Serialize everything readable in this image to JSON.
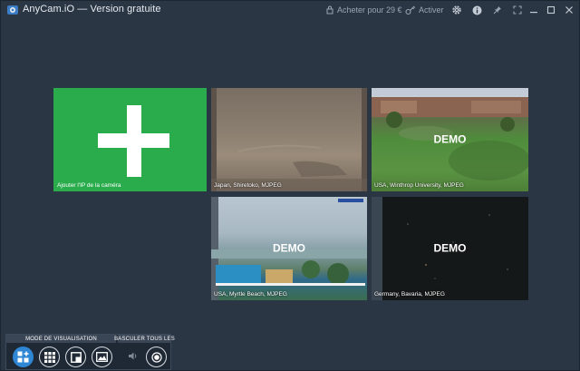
{
  "window": {
    "title": "AnyCam.iO — Version gratuite"
  },
  "titlebar": {
    "buy_label": "Acheter pour 29 €",
    "activate_label": "Activer",
    "icons": [
      "cart-icon",
      "key-icon",
      "gear-icon",
      "info-icon",
      "pin-icon",
      "fullscreen-icon",
      "minimize-icon",
      "maximize-icon",
      "close-icon"
    ]
  },
  "add_tile": {
    "label": "Ajouter l'IP de la caméra",
    "color": "#2aac4c"
  },
  "cameras": [
    {
      "caption": "Japan, Shiretoko, MJPEG",
      "demo": ""
    },
    {
      "caption": "USA, Winthrop University, MJPEG",
      "demo": "DEMO"
    },
    {
      "caption": "USA, Myrtle Beach, MJPEG",
      "demo": "DEMO"
    },
    {
      "caption": "Germany, Bavaria, MJPEG",
      "demo": "DEMO"
    }
  ],
  "toolbar": {
    "view_mode_label": "MODE DE VISUALISATION",
    "switch_all_label": "BASCULER TOUS LES",
    "active_color": "#2f86d4",
    "buttons": [
      "add-grid-icon",
      "grid-9-icon",
      "single-view-icon",
      "image-view-icon",
      "speaker-icon",
      "record-icon"
    ]
  },
  "colors": {
    "background": "#2b3645",
    "accent_green": "#2aac4c"
  }
}
